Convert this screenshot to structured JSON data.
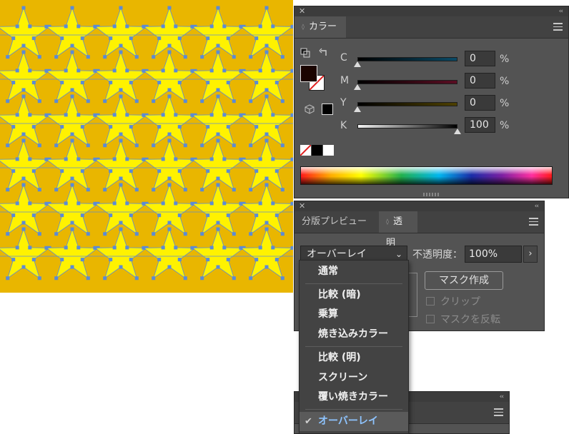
{
  "color_panel": {
    "tab_label": "カラー",
    "channels": [
      {
        "label": "C",
        "value": "0",
        "unit": "%",
        "level_pct": 0
      },
      {
        "label": "M",
        "value": "0",
        "unit": "%",
        "level_pct": 0
      },
      {
        "label": "Y",
        "value": "0",
        "unit": "%",
        "level_pct": 0
      },
      {
        "label": "K",
        "value": "100",
        "unit": "%",
        "level_pct": 100
      }
    ],
    "fill_color": "#1a0400",
    "accent": {
      "artboard": "#E9B600",
      "star_fill": "#FFF200",
      "anchor": "#5b8bd6"
    }
  },
  "transparency_panel": {
    "tabs": [
      "分版プレビュー",
      "透明"
    ],
    "blend_mode": "オーバーレイ",
    "opacity_label": "不透明度：",
    "opacity_value": "100%",
    "mask_button": "マスク作成",
    "clip_label": "クリップ",
    "invert_label": "マスクを反転"
  },
  "blend_menu": {
    "items": [
      "通常",
      "比較 (暗)",
      "乗算",
      "焼き込みカラー",
      "比較 (明)",
      "スクリーン",
      "覆い焼きカラー",
      "オーバーレイ"
    ],
    "selected": "オーバーレイ"
  }
}
